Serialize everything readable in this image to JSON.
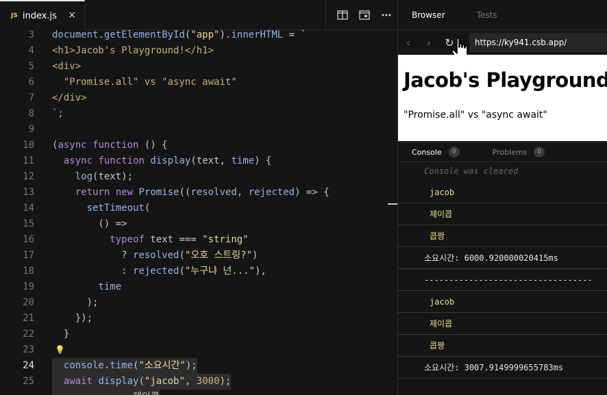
{
  "editor": {
    "tab": {
      "icon_label": "JS",
      "filename": "index.js",
      "close": "×"
    },
    "active_line": 24,
    "lines": [
      {
        "n": "3",
        "t": "document.getElementById(\"app\").innerHTML = `"
      },
      {
        "n": "4",
        "t": "<h1>Jacob's Playground!</h1>"
      },
      {
        "n": "5",
        "t": "<div>"
      },
      {
        "n": "6",
        "t": "  \"Promise.all\" vs \"async await\""
      },
      {
        "n": "7",
        "t": "</div>"
      },
      {
        "n": "8",
        "t": "`;"
      },
      {
        "n": "9",
        "t": ""
      },
      {
        "n": "10",
        "t": "(async function () {"
      },
      {
        "n": "11",
        "t": "  async function display(text, time) {"
      },
      {
        "n": "12",
        "t": "    log(text);"
      },
      {
        "n": "13",
        "t": "    return new Promise((resolved, rejected) => {"
      },
      {
        "n": "14",
        "t": "      setTimeout("
      },
      {
        "n": "15",
        "t": "        () =>"
      },
      {
        "n": "16",
        "t": "          typeof text === \"string\""
      },
      {
        "n": "17",
        "t": "            ? resolved(\"오호 스트링?\")"
      },
      {
        "n": "18",
        "t": "            : rejected(\"누구냐 넌...\"),"
      },
      {
        "n": "19",
        "t": "        time"
      },
      {
        "n": "20",
        "t": "      );"
      },
      {
        "n": "21",
        "t": "    });"
      },
      {
        "n": "22",
        "t": "  }"
      },
      {
        "n": "23",
        "t": ""
      },
      {
        "n": "24",
        "t": "  console.time(\"소요시간\");"
      },
      {
        "n": "25",
        "t": "  await display(\"jacob\", 3000);"
      },
      {
        "n": "",
        "t": "              제이콥"
      }
    ]
  },
  "preview": {
    "tabs": [
      "Browser",
      "Tests"
    ],
    "url": "https://ky941.csb.app/",
    "page": {
      "heading": "Jacob's Playground!",
      "text": "\"Promise.all\" vs \"async await\""
    },
    "console_tabs": [
      {
        "label": "Console",
        "count": "0"
      },
      {
        "label": "Problems",
        "count": "0"
      }
    ],
    "console": {
      "cleared": "Console was cleared",
      "entries": [
        {
          "type": "str",
          "text": "jacob"
        },
        {
          "type": "str",
          "text": "제이콥"
        },
        {
          "type": "str",
          "text": "콥짱"
        },
        {
          "type": "plain",
          "text": "소요시간: 6000.920000020415ms"
        },
        {
          "type": "plain",
          "text": "----------------------------------"
        },
        {
          "type": "str",
          "text": "jacob"
        },
        {
          "type": "str",
          "text": "제이콥"
        },
        {
          "type": "str",
          "text": "콥짱"
        },
        {
          "type": "plain",
          "text": "소요시간: 3007.9149999655783ms"
        }
      ]
    }
  },
  "colors": {
    "string": "#e8d89a",
    "keyword": "#b58ad9",
    "function": "#90b7e8",
    "accent_line": "#e5e5e5"
  }
}
